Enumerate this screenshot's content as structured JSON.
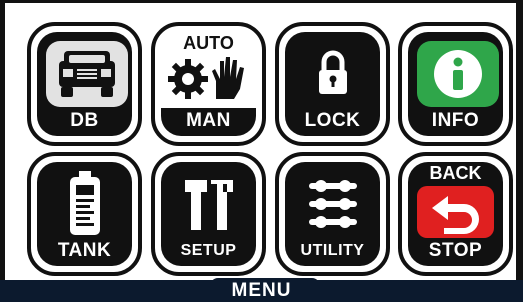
{
  "tiles": [
    {
      "label": "DB",
      "icon": "car-icon"
    },
    {
      "top": "AUTO",
      "label": "MAN",
      "icon": "gear-hand-icon"
    },
    {
      "label": "LOCK",
      "icon": "padlock-icon"
    },
    {
      "label": "INFO",
      "icon": "info-icon",
      "color": "#2fa64a"
    },
    {
      "label": "TANK",
      "icon": "tank-icon"
    },
    {
      "label": "SETUP",
      "icon": "tools-icon"
    },
    {
      "label": "UTILITY",
      "icon": "sliders-icon"
    },
    {
      "top": "BACK",
      "label": "STOP",
      "icon": "back-arrow-icon",
      "color": "#e02020"
    }
  ],
  "footer": {
    "title": "MENU"
  }
}
